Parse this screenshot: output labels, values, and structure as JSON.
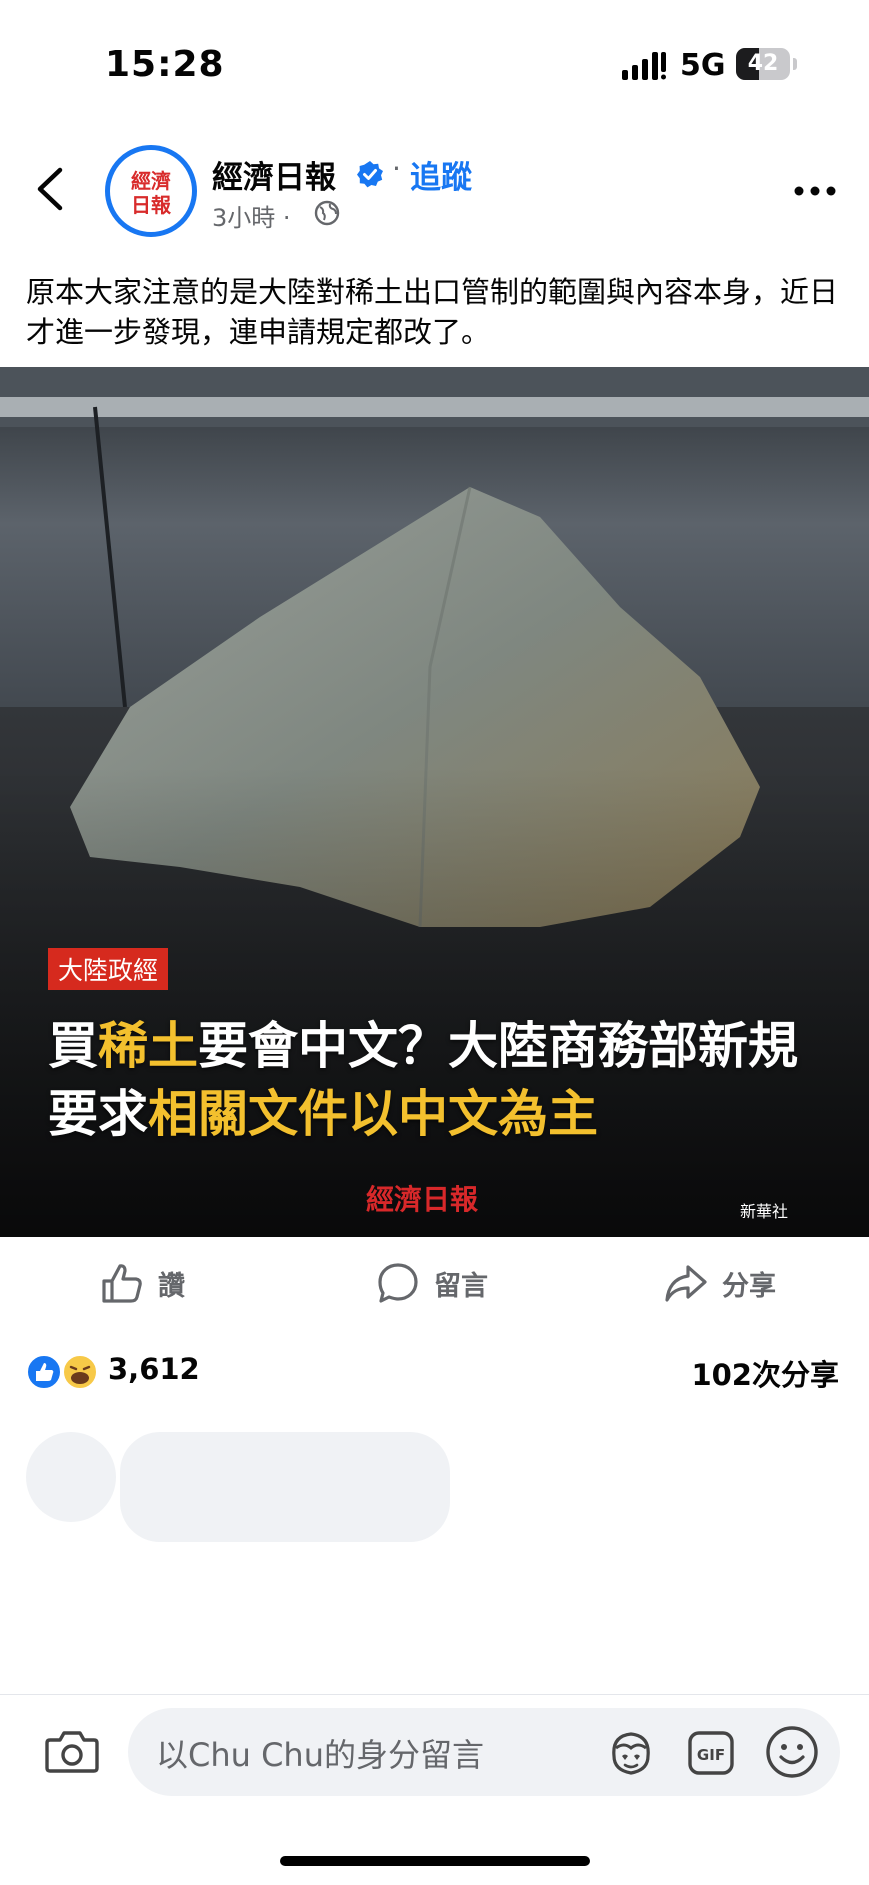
{
  "status_bar": {
    "time": "15:28",
    "network": "5G",
    "battery_text": "42",
    "battery_level": 0.42
  },
  "post": {
    "page_name": "經濟日報",
    "avatar_lines": [
      "經濟",
      "日報"
    ],
    "follow_separator": "·",
    "follow_label": "追蹤",
    "time": "3小時 ·",
    "caption": "原本大家注意的是大陸對稀土出口管制的範圍與內容本身，近日才進一步發現，連申請規定都改了。"
  },
  "image": {
    "tag": "大陸政經",
    "headline": {
      "p1": "買",
      "p2": "稀土",
      "p3": "要會中文？大陸商務部新規  要求",
      "p4": "相關文件以中文為主"
    },
    "watermark": "經濟日報",
    "credit": "新華社"
  },
  "actions": {
    "like": "讚",
    "comment": "留言",
    "share": "分享"
  },
  "stats": {
    "reactions_count": "3,612",
    "shares": "102次分享"
  },
  "composer": {
    "placeholder": "以Chu Chu的身分留言"
  },
  "colors": {
    "accent": "#1877f2",
    "headline_yellow": "#f3c02e",
    "tag_red": "#d62a1e"
  },
  "icons": [
    "chevron-left-icon",
    "verified-icon",
    "globe-icon",
    "more-icon",
    "like-icon",
    "comment-icon",
    "share-icon",
    "camera-icon",
    "avatar-sticker-icon",
    "gif-icon",
    "emoji-icon"
  ]
}
